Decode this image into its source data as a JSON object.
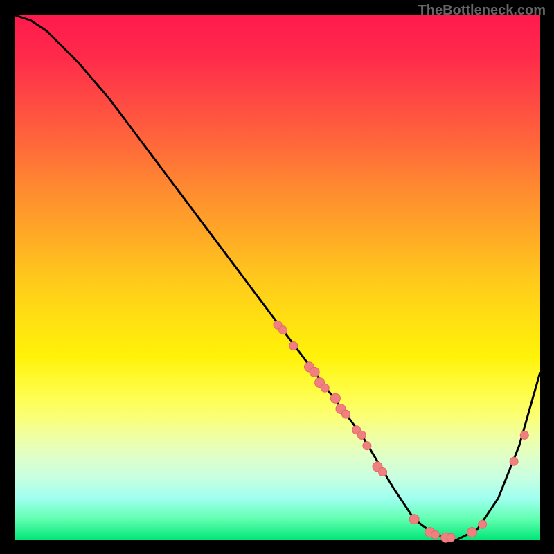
{
  "watermark": "TheBottleneck.com",
  "chart_data": {
    "type": "line",
    "title": "",
    "xlabel": "",
    "ylabel": "",
    "xlim": [
      0,
      100
    ],
    "ylim": [
      0,
      100
    ],
    "curve": {
      "x": [
        0,
        3,
        6,
        9,
        12,
        18,
        24,
        30,
        36,
        42,
        48,
        54,
        60,
        66,
        72,
        76,
        80,
        84,
        88,
        92,
        96,
        100
      ],
      "y": [
        100,
        99,
        97,
        94,
        91,
        84,
        76,
        68,
        60,
        52,
        44,
        36,
        28,
        20,
        10,
        4,
        1,
        0,
        2,
        8,
        18,
        32
      ]
    },
    "markers": [
      {
        "x": 50,
        "y": 41,
        "r": 6
      },
      {
        "x": 51,
        "y": 40,
        "r": 6
      },
      {
        "x": 53,
        "y": 37,
        "r": 6
      },
      {
        "x": 56,
        "y": 33,
        "r": 7
      },
      {
        "x": 57,
        "y": 32,
        "r": 7
      },
      {
        "x": 58,
        "y": 30,
        "r": 7
      },
      {
        "x": 59,
        "y": 29,
        "r": 6
      },
      {
        "x": 61,
        "y": 27,
        "r": 7
      },
      {
        "x": 62,
        "y": 25,
        "r": 7
      },
      {
        "x": 63,
        "y": 24,
        "r": 6
      },
      {
        "x": 65,
        "y": 21,
        "r": 6
      },
      {
        "x": 66,
        "y": 20,
        "r": 6
      },
      {
        "x": 67,
        "y": 18,
        "r": 6
      },
      {
        "x": 69,
        "y": 14,
        "r": 7
      },
      {
        "x": 70,
        "y": 13,
        "r": 6
      },
      {
        "x": 76,
        "y": 4,
        "r": 7
      },
      {
        "x": 79,
        "y": 1.5,
        "r": 7
      },
      {
        "x": 80,
        "y": 1,
        "r": 6
      },
      {
        "x": 82,
        "y": 0.5,
        "r": 7
      },
      {
        "x": 83,
        "y": 0.5,
        "r": 6
      },
      {
        "x": 87,
        "y": 1.5,
        "r": 7
      },
      {
        "x": 89,
        "y": 3,
        "r": 6
      },
      {
        "x": 95,
        "y": 15,
        "r": 6
      },
      {
        "x": 97,
        "y": 20,
        "r": 6
      }
    ],
    "colors": {
      "curve": "#000000",
      "marker_fill": "#f08080",
      "marker_stroke": "#e06868"
    }
  }
}
